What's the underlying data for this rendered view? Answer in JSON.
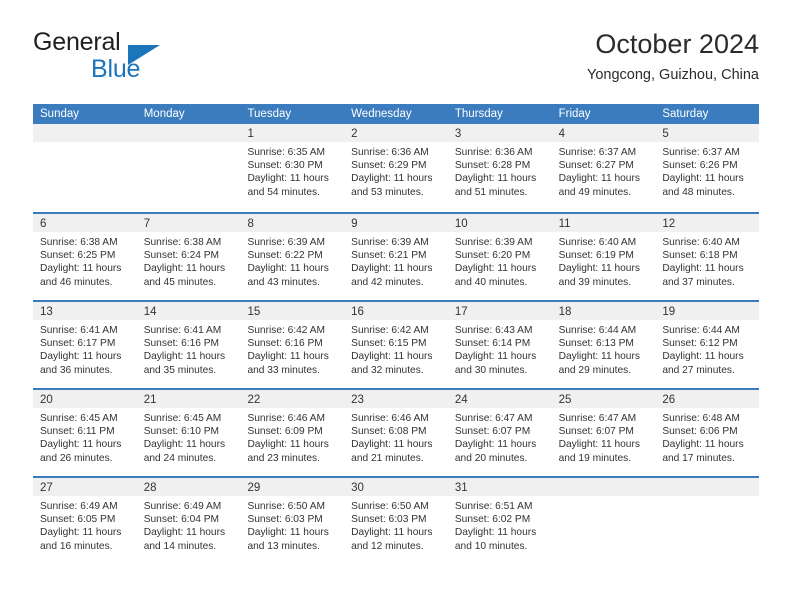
{
  "brand": {
    "line1": "General",
    "line2": "Blue",
    "accent_color": "#1b75bb"
  },
  "header": {
    "title": "October 2024",
    "location": "Yongcong, Guizhou, China"
  },
  "theme": {
    "header_bg": "#3b7cbf",
    "daynum_bg": "#f0f0f0",
    "text": "#333333"
  },
  "weekdays": [
    "Sunday",
    "Monday",
    "Tuesday",
    "Wednesday",
    "Thursday",
    "Friday",
    "Saturday"
  ],
  "weeks": [
    [
      {
        "day": "",
        "lines": []
      },
      {
        "day": "",
        "lines": []
      },
      {
        "day": "1",
        "lines": [
          "Sunrise: 6:35 AM",
          "Sunset: 6:30 PM",
          "Daylight: 11 hours",
          "and 54 minutes."
        ]
      },
      {
        "day": "2",
        "lines": [
          "Sunrise: 6:36 AM",
          "Sunset: 6:29 PM",
          "Daylight: 11 hours",
          "and 53 minutes."
        ]
      },
      {
        "day": "3",
        "lines": [
          "Sunrise: 6:36 AM",
          "Sunset: 6:28 PM",
          "Daylight: 11 hours",
          "and 51 minutes."
        ]
      },
      {
        "day": "4",
        "lines": [
          "Sunrise: 6:37 AM",
          "Sunset: 6:27 PM",
          "Daylight: 11 hours",
          "and 49 minutes."
        ]
      },
      {
        "day": "5",
        "lines": [
          "Sunrise: 6:37 AM",
          "Sunset: 6:26 PM",
          "Daylight: 11 hours",
          "and 48 minutes."
        ]
      }
    ],
    [
      {
        "day": "6",
        "lines": [
          "Sunrise: 6:38 AM",
          "Sunset: 6:25 PM",
          "Daylight: 11 hours",
          "and 46 minutes."
        ]
      },
      {
        "day": "7",
        "lines": [
          "Sunrise: 6:38 AM",
          "Sunset: 6:24 PM",
          "Daylight: 11 hours",
          "and 45 minutes."
        ]
      },
      {
        "day": "8",
        "lines": [
          "Sunrise: 6:39 AM",
          "Sunset: 6:22 PM",
          "Daylight: 11 hours",
          "and 43 minutes."
        ]
      },
      {
        "day": "9",
        "lines": [
          "Sunrise: 6:39 AM",
          "Sunset: 6:21 PM",
          "Daylight: 11 hours",
          "and 42 minutes."
        ]
      },
      {
        "day": "10",
        "lines": [
          "Sunrise: 6:39 AM",
          "Sunset: 6:20 PM",
          "Daylight: 11 hours",
          "and 40 minutes."
        ]
      },
      {
        "day": "11",
        "lines": [
          "Sunrise: 6:40 AM",
          "Sunset: 6:19 PM",
          "Daylight: 11 hours",
          "and 39 minutes."
        ]
      },
      {
        "day": "12",
        "lines": [
          "Sunrise: 6:40 AM",
          "Sunset: 6:18 PM",
          "Daylight: 11 hours",
          "and 37 minutes."
        ]
      }
    ],
    [
      {
        "day": "13",
        "lines": [
          "Sunrise: 6:41 AM",
          "Sunset: 6:17 PM",
          "Daylight: 11 hours",
          "and 36 minutes."
        ]
      },
      {
        "day": "14",
        "lines": [
          "Sunrise: 6:41 AM",
          "Sunset: 6:16 PM",
          "Daylight: 11 hours",
          "and 35 minutes."
        ]
      },
      {
        "day": "15",
        "lines": [
          "Sunrise: 6:42 AM",
          "Sunset: 6:16 PM",
          "Daylight: 11 hours",
          "and 33 minutes."
        ]
      },
      {
        "day": "16",
        "lines": [
          "Sunrise: 6:42 AM",
          "Sunset: 6:15 PM",
          "Daylight: 11 hours",
          "and 32 minutes."
        ]
      },
      {
        "day": "17",
        "lines": [
          "Sunrise: 6:43 AM",
          "Sunset: 6:14 PM",
          "Daylight: 11 hours",
          "and 30 minutes."
        ]
      },
      {
        "day": "18",
        "lines": [
          "Sunrise: 6:44 AM",
          "Sunset: 6:13 PM",
          "Daylight: 11 hours",
          "and 29 minutes."
        ]
      },
      {
        "day": "19",
        "lines": [
          "Sunrise: 6:44 AM",
          "Sunset: 6:12 PM",
          "Daylight: 11 hours",
          "and 27 minutes."
        ]
      }
    ],
    [
      {
        "day": "20",
        "lines": [
          "Sunrise: 6:45 AM",
          "Sunset: 6:11 PM",
          "Daylight: 11 hours",
          "and 26 minutes."
        ]
      },
      {
        "day": "21",
        "lines": [
          "Sunrise: 6:45 AM",
          "Sunset: 6:10 PM",
          "Daylight: 11 hours",
          "and 24 minutes."
        ]
      },
      {
        "day": "22",
        "lines": [
          "Sunrise: 6:46 AM",
          "Sunset: 6:09 PM",
          "Daylight: 11 hours",
          "and 23 minutes."
        ]
      },
      {
        "day": "23",
        "lines": [
          "Sunrise: 6:46 AM",
          "Sunset: 6:08 PM",
          "Daylight: 11 hours",
          "and 21 minutes."
        ]
      },
      {
        "day": "24",
        "lines": [
          "Sunrise: 6:47 AM",
          "Sunset: 6:07 PM",
          "Daylight: 11 hours",
          "and 20 minutes."
        ]
      },
      {
        "day": "25",
        "lines": [
          "Sunrise: 6:47 AM",
          "Sunset: 6:07 PM",
          "Daylight: 11 hours",
          "and 19 minutes."
        ]
      },
      {
        "day": "26",
        "lines": [
          "Sunrise: 6:48 AM",
          "Sunset: 6:06 PM",
          "Daylight: 11 hours",
          "and 17 minutes."
        ]
      }
    ],
    [
      {
        "day": "27",
        "lines": [
          "Sunrise: 6:49 AM",
          "Sunset: 6:05 PM",
          "Daylight: 11 hours",
          "and 16 minutes."
        ]
      },
      {
        "day": "28",
        "lines": [
          "Sunrise: 6:49 AM",
          "Sunset: 6:04 PM",
          "Daylight: 11 hours",
          "and 14 minutes."
        ]
      },
      {
        "day": "29",
        "lines": [
          "Sunrise: 6:50 AM",
          "Sunset: 6:03 PM",
          "Daylight: 11 hours",
          "and 13 minutes."
        ]
      },
      {
        "day": "30",
        "lines": [
          "Sunrise: 6:50 AM",
          "Sunset: 6:03 PM",
          "Daylight: 11 hours",
          "and 12 minutes."
        ]
      },
      {
        "day": "31",
        "lines": [
          "Sunrise: 6:51 AM",
          "Sunset: 6:02 PM",
          "Daylight: 11 hours",
          "and 10 minutes."
        ]
      },
      {
        "day": "",
        "lines": []
      },
      {
        "day": "",
        "lines": []
      }
    ]
  ]
}
